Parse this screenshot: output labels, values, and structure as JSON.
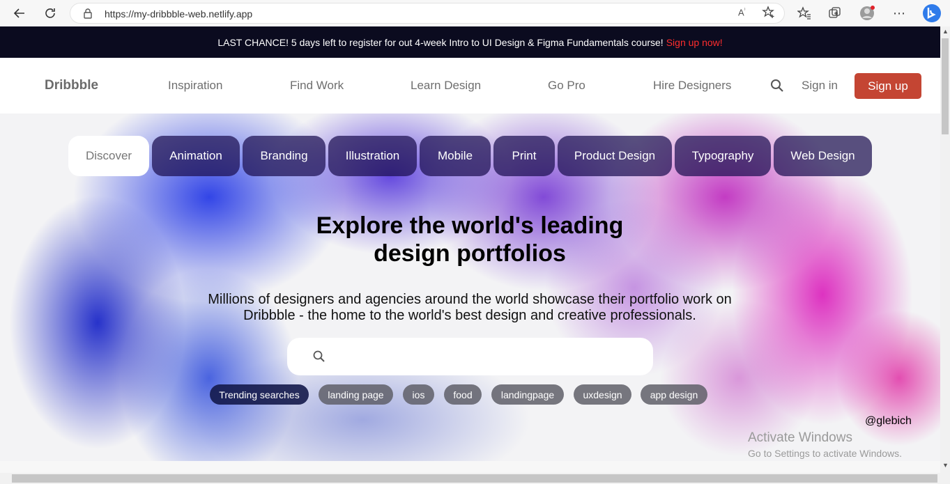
{
  "browser": {
    "url": "https://my-dribbble-web.netlify.app",
    "icons": [
      "back-arrow-icon",
      "refresh-icon",
      "lock-icon",
      "read-aloud-icon",
      "favorite-add-icon",
      "favorites-icon",
      "collections-icon",
      "profile-avatar-icon",
      "more-icon",
      "bing-icon"
    ]
  },
  "promo": {
    "text": "LAST CHANCE! 5 days left to register for out 4-week Intro to UI Design & Figma Fundamentals course!",
    "cta": "Sign up now!",
    "cta_color": "#ff2d2d"
  },
  "header": {
    "logo": "Dribbble",
    "nav": [
      "Inspiration",
      "Find Work",
      "Learn Design",
      "Go Pro",
      "Hire Designers"
    ],
    "signin": "Sign in",
    "signup": "Sign up",
    "accent": "#c44533"
  },
  "hero": {
    "categories": [
      "Discover",
      "Animation",
      "Branding",
      "Illustration",
      "Mobile",
      "Print",
      "Product Design",
      "Typography",
      "Web Design"
    ],
    "title_line1": "Explore the world's leading",
    "title_line2": "design portfolios",
    "subtitle_line1": "Millions of designers and agencies around the world showcase their portfolio work on",
    "subtitle_line2": "Dribbble - the home to the world's best design and creative professionals.",
    "search_placeholder": "",
    "tags": [
      "Trending searches",
      "landing page",
      "ios",
      "food",
      "landingpage",
      "uxdesign",
      "app design"
    ],
    "credit": "@glebich"
  },
  "watermark": {
    "line1": "Activate Windows",
    "line2": "Go to Settings to activate Windows."
  }
}
